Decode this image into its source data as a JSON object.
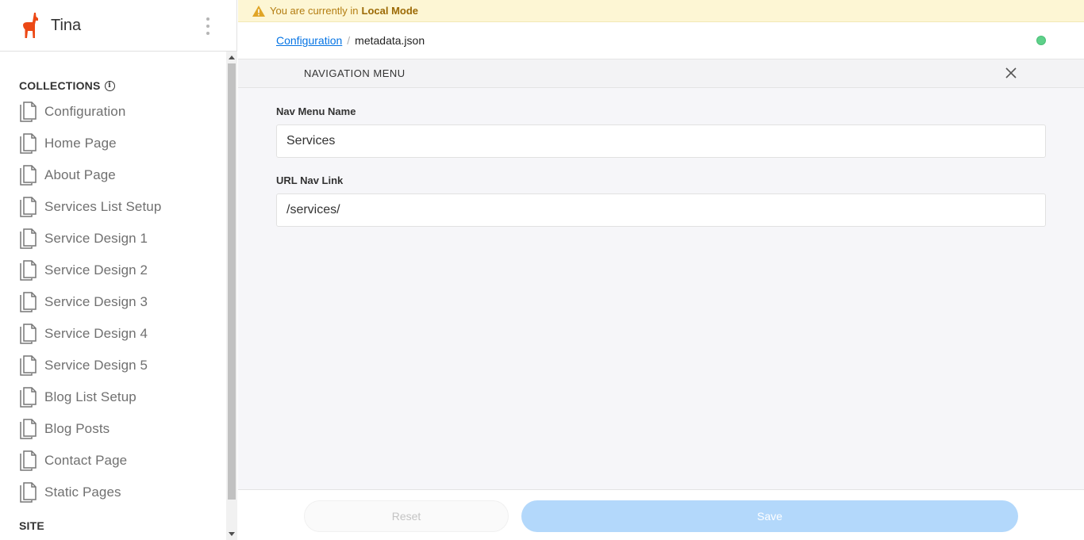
{
  "app": {
    "title": "Tina",
    "logo_icon": "llama-icon",
    "menu_icon": "kebab-menu-icon"
  },
  "sidebar": {
    "collections_heading": "COLLECTIONS",
    "info_icon": "i",
    "items": [
      {
        "label": "Configuration",
        "icon": "document-icon"
      },
      {
        "label": "Home Page",
        "icon": "document-icon"
      },
      {
        "label": "About Page",
        "icon": "document-icon"
      },
      {
        "label": "Services List Setup",
        "icon": "document-icon"
      },
      {
        "label": "Service Design 1",
        "icon": "document-icon"
      },
      {
        "label": "Service Design 2",
        "icon": "document-icon"
      },
      {
        "label": "Service Design 3",
        "icon": "document-icon"
      },
      {
        "label": "Service Design 4",
        "icon": "document-icon"
      },
      {
        "label": "Service Design 5",
        "icon": "document-icon"
      },
      {
        "label": "Blog List Setup",
        "icon": "document-icon"
      },
      {
        "label": "Blog Posts",
        "icon": "document-icon"
      },
      {
        "label": "Contact Page",
        "icon": "document-icon"
      },
      {
        "label": "Static Pages",
        "icon": "document-icon"
      }
    ],
    "site_heading": "SITE"
  },
  "banner": {
    "text": "You are currently in",
    "mode": "Local Mode",
    "icon": "warning-icon"
  },
  "breadcrumb": {
    "parent": "Configuration",
    "separator": "/",
    "current": "metadata.json",
    "status_color": "#5ed18a"
  },
  "panel": {
    "title": "NAVIGATION MENU",
    "close_icon": "close-icon"
  },
  "form": {
    "fields": [
      {
        "label": "Nav Menu Name",
        "value": "Services"
      },
      {
        "label": "URL Nav Link",
        "value": "/services/"
      }
    ]
  },
  "footer": {
    "reset_label": "Reset",
    "save_label": "Save"
  },
  "colors": {
    "accent": "#0574e4",
    "brand": "#ec4815",
    "save_disabled": "#b3d8fb",
    "banner_bg": "#fdf6d4"
  }
}
